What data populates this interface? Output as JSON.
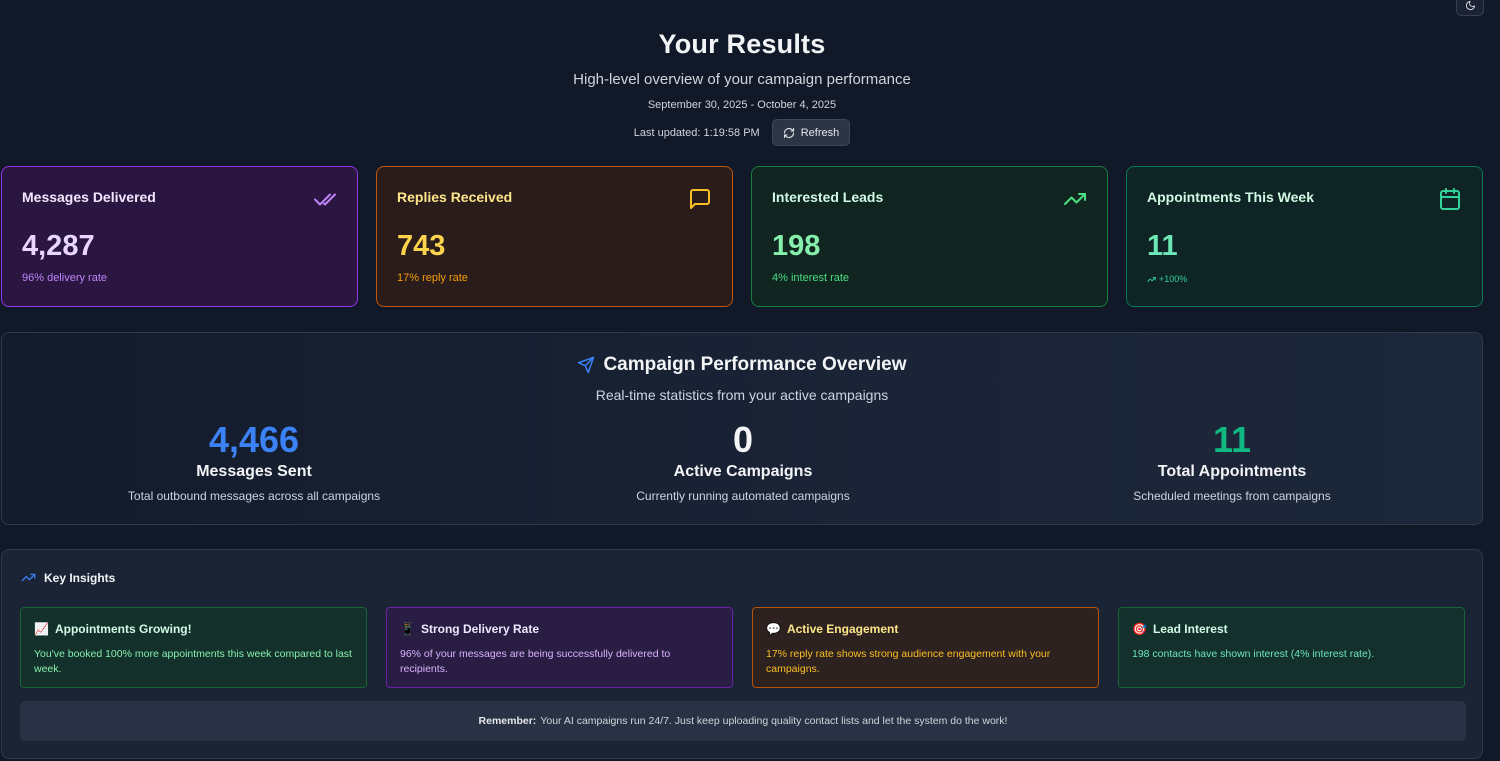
{
  "header": {
    "title": "Your Results",
    "subtitle": "High-level overview of your campaign performance",
    "date_range": "September 30, 2025 - October 4, 2025",
    "last_updated": "Last updated: 1:19:58 PM",
    "refresh_label": "Refresh"
  },
  "stats": [
    {
      "label": "Messages Delivered",
      "value": "4,287",
      "sub": "96% delivery rate",
      "icon": "double-check-icon"
    },
    {
      "label": "Replies Received",
      "value": "743",
      "sub": "17% reply rate",
      "icon": "message-square-icon"
    },
    {
      "label": "Interested Leads",
      "value": "198",
      "sub": "4% interest rate",
      "icon": "trending-up-icon"
    },
    {
      "label": "Appointments This Week",
      "value": "11",
      "sub": "+100%",
      "icon": "calendar-icon"
    }
  ],
  "overview": {
    "title": "Campaign Performance Overview",
    "subtitle": "Real-time statistics from your active campaigns",
    "metrics": [
      {
        "value": "4,466",
        "label": "Messages Sent",
        "desc": "Total outbound messages across all campaigns",
        "color": "#3b82f6"
      },
      {
        "value": "0",
        "label": "Active Campaigns",
        "desc": "Currently running automated campaigns",
        "color": "#f3f4f6"
      },
      {
        "value": "11",
        "label": "Total Appointments",
        "desc": "Scheduled meetings from campaigns",
        "color": "#10b981"
      }
    ]
  },
  "insights": {
    "title": "Key Insights",
    "cards": [
      {
        "emoji": "📈",
        "title": "Appointments Growing!",
        "body": "You've booked 100% more appointments this week compared to last week."
      },
      {
        "emoji": "📱",
        "title": "Strong Delivery Rate",
        "body": "96% of your messages are being successfully delivered to recipients."
      },
      {
        "emoji": "💬",
        "title": "Active Engagement",
        "body": "17% reply rate shows strong audience engagement with your campaigns."
      },
      {
        "emoji": "🎯",
        "title": "Lead Interest",
        "body": "198 contacts have shown interest (4% interest rate)."
      }
    ],
    "remember_label": "Remember:",
    "remember_text": "Your AI campaigns run 24/7. Just keep uploading quality contact lists and let the system do the work!"
  },
  "colors": {
    "background": "#111827",
    "purple": "#9333ea",
    "orange": "#c2580c",
    "green": "#15803d",
    "blue": "#3b82f6"
  }
}
